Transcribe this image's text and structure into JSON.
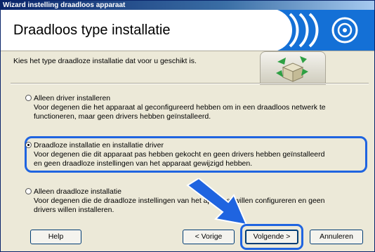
{
  "window": {
    "title": "Wizard instelling draadloos apparaat"
  },
  "header": {
    "title": "Draadloos type installatie"
  },
  "instruction": "Kies het type draadloze installatie dat voor u geschikt is.",
  "options": [
    {
      "label": "Alleen driver installeren",
      "line1": "Voor degenen die het apparaat al geconfigureerd hebben om in een draadloos netwerk te",
      "line2": "functioneren, maar geen drivers hebben geïnstalleerd.",
      "selected": false
    },
    {
      "label": "Draadloze installatie en installatie driver",
      "line1": "Voor degenen die dit apparaat pas hebben gekocht en geen drivers hebben geïnstalleerd",
      "line2": "en geen draadloze instellingen van het apparaat gewijzigd hebben.",
      "selected": true
    },
    {
      "label": "Alleen draadloze installatie",
      "line1": "Voor degenen die de draadloze instellingen van het apparaat willen configureren en geen",
      "line2": "drivers willen installeren.",
      "selected": false
    }
  ],
  "buttons": {
    "help": "Help",
    "back": "< Vorige",
    "next": "Volgende >",
    "cancel": "Annuleren"
  },
  "colors": {
    "highlight": "#1f64e0",
    "titlebar": "#0a246a"
  }
}
